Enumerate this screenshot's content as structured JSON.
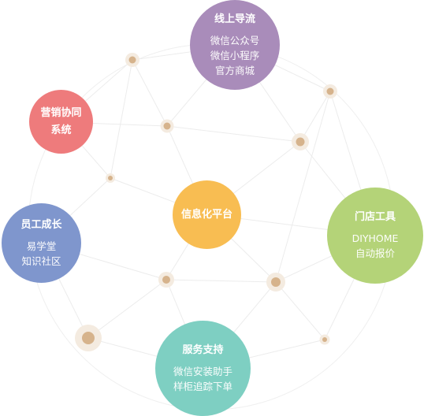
{
  "diagram": {
    "nodes": [
      {
        "id": "online",
        "title": "线上导流",
        "lines": [
          "微信公众号",
          "微信小程序",
          "官方商城"
        ],
        "color": "#a98cba"
      },
      {
        "id": "marketing",
        "title": "营销协同",
        "lines": [
          "系统"
        ],
        "color": "#ee7b7c"
      },
      {
        "id": "info",
        "title": "信息化平台",
        "lines": [],
        "color": "#f8bd52"
      },
      {
        "id": "staff",
        "title": "员工成长",
        "lines": [
          "易学堂",
          "知识社区"
        ],
        "color": "#7f96cd"
      },
      {
        "id": "store",
        "title": "门店工具",
        "lines": [
          "DIYHOME",
          "自动报价"
        ],
        "color": "#b4d378"
      },
      {
        "id": "service",
        "title": "服务支持",
        "lines": [
          "微信安装助手",
          "样柜追踪下单"
        ],
        "color": "#7ecfc2"
      }
    ],
    "colors": {
      "line": "#ececec",
      "dot": "#d6b38c",
      "dot_halo": "#f4ebe0"
    }
  }
}
